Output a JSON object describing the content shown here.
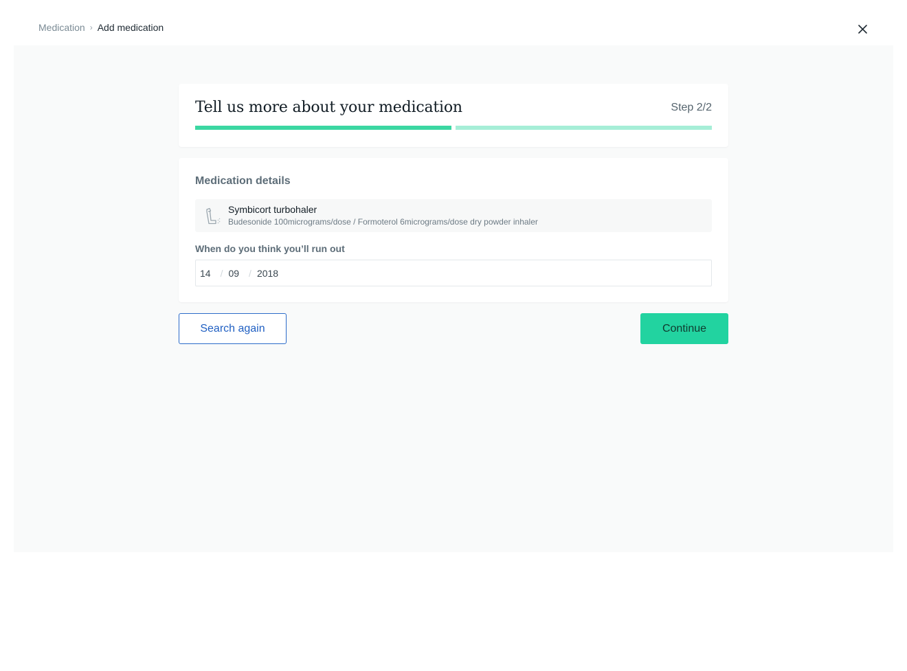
{
  "breadcrumb": {
    "parent": "Medication",
    "separator": "›",
    "current": "Add medication"
  },
  "header": {
    "title": "Tell us more about your medication",
    "step": "Step 2/2",
    "progress": {
      "completed_steps": 1,
      "current_step": 2,
      "total_steps": 2
    }
  },
  "details": {
    "section_title": "Medication details",
    "medication": {
      "icon": "inhaler-icon",
      "name": "Symbicort turbohaler",
      "description": "Budesonide 100micrograms/dose / Formoterol 6micrograms/dose dry powder inhaler"
    },
    "run_out_label": "When do you think you’ll run out",
    "run_out_date": {
      "day": "14",
      "month": "09",
      "year": "2018",
      "separator": "/"
    }
  },
  "actions": {
    "search_again": "Search again",
    "continue": "Continue"
  },
  "colors": {
    "accent": "#22d3a0",
    "progress_done": "#3bd7a2",
    "progress_active": "#a6eed7",
    "link_blue": "#1f5fc2"
  }
}
